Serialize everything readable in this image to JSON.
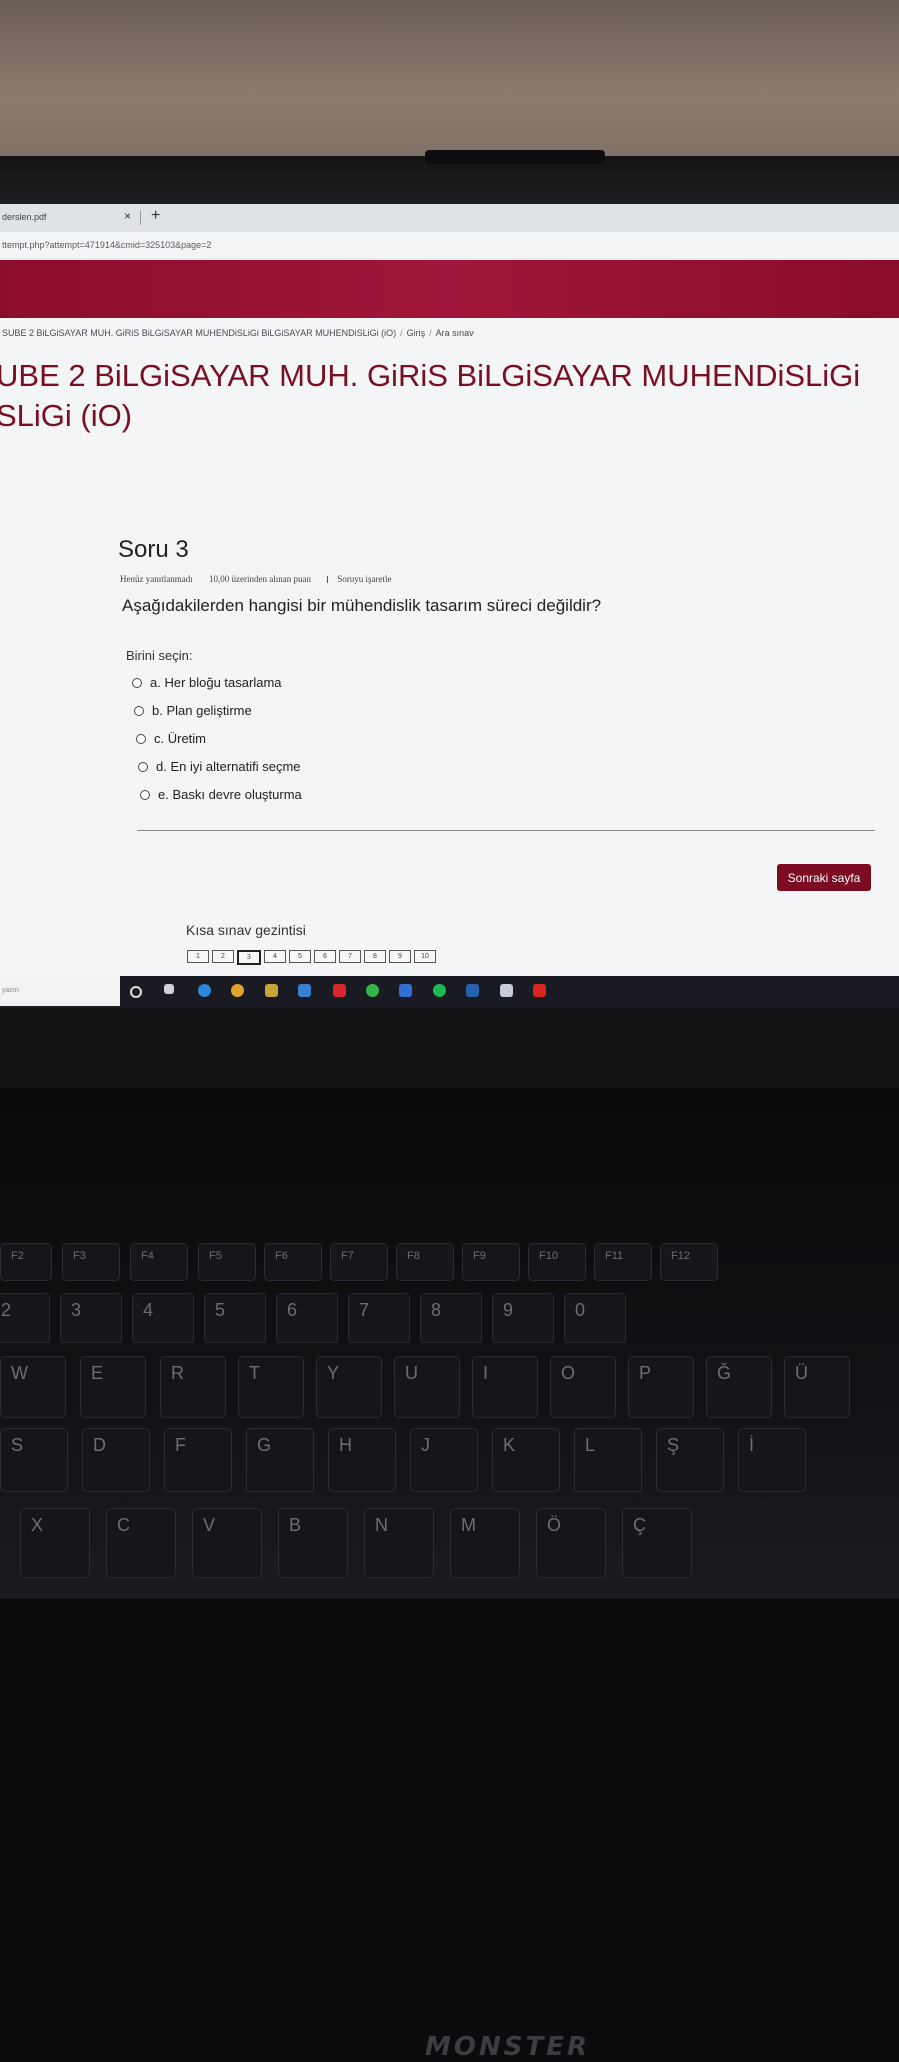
{
  "browser": {
    "tab_title": "derslen.pdf",
    "tab_close": "×",
    "new_tab": "+",
    "url": "ttempt.php?attempt=471914&cmid=325103&page=2"
  },
  "breadcrumb": {
    "course": "SUBE 2 BiLGiSAYAR MUH. GiRiS BiLGiSAYAR MUHENDiSLiGi BiLGiSAYAR MUHENDiSLiGi (iO)",
    "section": "Giriş",
    "page": "Ara sınav"
  },
  "course_title": {
    "line1": "UBE 2 BiLGiSAYAR MUH. GiRiS BiLGiSAYAR MUHENDiSLiGi",
    "line2": "SLiGi (iO)"
  },
  "question": {
    "heading": "Soru 3",
    "status": "Henüz yanıtlanmadı",
    "points": "10,00 üzerinden alınan puan",
    "flag": "Soruyu işaretle",
    "text": "Aşağıdakilerden hangisi bir mühendislik tasarım süreci değildir?",
    "prompt": "Birini seçin:",
    "options": [
      "a. Her bloğu tasarlama",
      "b. Plan geliştirme",
      "c. Üretim",
      "d. En iyi alternatifi seçme",
      "e. Baskı devre oluşturma"
    ]
  },
  "next_button": "Sonraki sayfa",
  "quiz_nav": {
    "title": "Kısa sınav gezintisi",
    "pages": [
      "1",
      "2",
      "3",
      "4",
      "5",
      "6",
      "7",
      "8",
      "9",
      "10"
    ],
    "current_page": "3"
  },
  "taskbar": {
    "search_placeholder": "yazın"
  },
  "laptop": {
    "brand": "MONSTER"
  },
  "keyboard": {
    "row_fn": [
      "F2",
      "F3",
      "F4",
      "F5",
      "F6",
      "F7",
      "F8",
      "F9",
      "F10",
      "F11",
      "F12"
    ],
    "row_num": [
      "2",
      "3",
      "4",
      "5",
      "6",
      "7",
      "8",
      "9",
      "0"
    ],
    "row_q": [
      "W",
      "E",
      "R",
      "T",
      "Y",
      "U",
      "I",
      "O",
      "P",
      "Ğ",
      "Ü"
    ],
    "row_a": [
      "S",
      "D",
      "F",
      "G",
      "H",
      "J",
      "K",
      "L",
      "Ş",
      "İ"
    ],
    "row_z": [
      "X",
      "C",
      "V",
      "B",
      "N",
      "M",
      "Ö",
      "Ç"
    ]
  }
}
